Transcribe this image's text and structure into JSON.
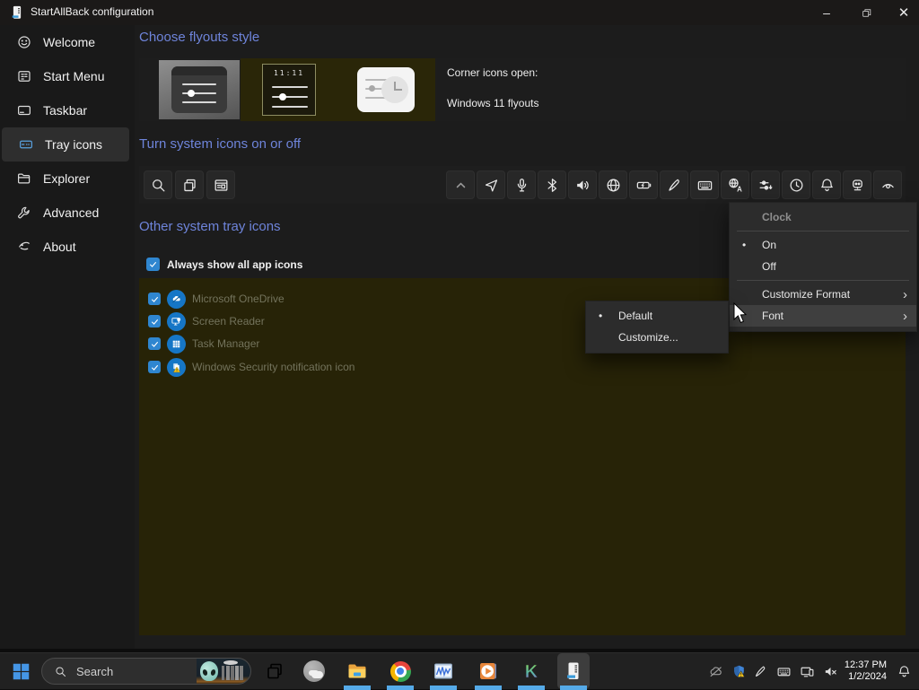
{
  "window": {
    "title": "StartAllBack configuration",
    "caption_buttons": [
      "minimize",
      "restore",
      "close"
    ]
  },
  "sidebar": {
    "items": [
      {
        "label": "Welcome",
        "icon": "welcome-icon",
        "selected": false
      },
      {
        "label": "Start Menu",
        "icon": "startmenu-icon",
        "selected": false
      },
      {
        "label": "Taskbar",
        "icon": "taskbar-icon",
        "selected": false
      },
      {
        "label": "Tray icons",
        "icon": "tray-icon",
        "selected": true
      },
      {
        "label": "Explorer",
        "icon": "explorer-icon",
        "selected": false
      },
      {
        "label": "Advanced",
        "icon": "advanced-icon",
        "selected": false
      },
      {
        "label": "About",
        "icon": "about-icon",
        "selected": false
      }
    ]
  },
  "main": {
    "heading_flyouts": "Choose flyouts style",
    "heading_system_icons": "Turn system icons on or off",
    "heading_other": "Other system tray icons",
    "flyout_tiles": [
      "dark-flyout-selected",
      "clock-flyout",
      "light-flyout"
    ],
    "clock_tile_digits": "11:11",
    "corner_label_1": "Corner icons open:",
    "corner_label_2": "Windows 11 flyouts",
    "toolbar_icons": [
      "search",
      "task-view",
      "news"
    ],
    "system_icons": [
      "collapse-chevron",
      "location",
      "microphone",
      "bluetooth",
      "volume",
      "network-globe",
      "battery",
      "pen",
      "touch-keyboard",
      "language",
      "volume-mixer",
      "clock",
      "notifications",
      "copilot",
      "privacy-eye"
    ],
    "always_show_label": "Always show all app icons",
    "always_show_checked": true,
    "tray_app_list": [
      {
        "label": "Microsoft OneDrive",
        "icon": "onedrive",
        "checked": true
      },
      {
        "label": "Screen Reader",
        "icon": "screen-reader",
        "checked": true
      },
      {
        "label": "Task Manager",
        "icon": "task-manager",
        "checked": true
      },
      {
        "label": "Windows Security notification icon",
        "icon": "windows-security",
        "checked": true
      }
    ]
  },
  "context_menu": {
    "title": "Clock",
    "items": [
      {
        "label": "On",
        "bullet": "•",
        "selected": true
      },
      {
        "label": "Off",
        "selected": false
      },
      {
        "label": "Customize Format",
        "chevron": "›",
        "has_submenu": true
      },
      {
        "label": "Font",
        "chevron": "›",
        "has_submenu": true,
        "highlighted": true
      }
    ]
  },
  "font_submenu": {
    "items": [
      {
        "label": "Default",
        "bullet": "•",
        "selected": true
      },
      {
        "label": "Customize..."
      }
    ]
  },
  "taskbar": {
    "search": {
      "placeholder": "Search",
      "thumbnail": "alien-scene-image"
    },
    "apps": [
      {
        "name": "start"
      },
      {
        "name": "task-view"
      },
      {
        "name": "widgets"
      },
      {
        "name": "file-explorer",
        "running": true
      },
      {
        "name": "chrome",
        "running": true
      },
      {
        "name": "performance-monitor",
        "running": true
      },
      {
        "name": "media-player",
        "running": true
      },
      {
        "name": "kmplayer",
        "running": true
      },
      {
        "name": "startallback",
        "running": true,
        "active": true
      }
    ],
    "tray_icons": [
      "onedrive-off",
      "windows-security",
      "pen",
      "touch-keyboard",
      "cast-display",
      "volume-muted"
    ],
    "clock": {
      "time": "12:37 PM",
      "date": "1/2/2024"
    },
    "notifications": "bell"
  },
  "colors": {
    "heading_accent": "#6e84da",
    "checkbox_blue": "#2f86d0",
    "badge_blue": "#1676c6",
    "run_indicator": "#55aae8",
    "olive_panel": "#272307",
    "menu_bg": "#2c2c2c"
  }
}
